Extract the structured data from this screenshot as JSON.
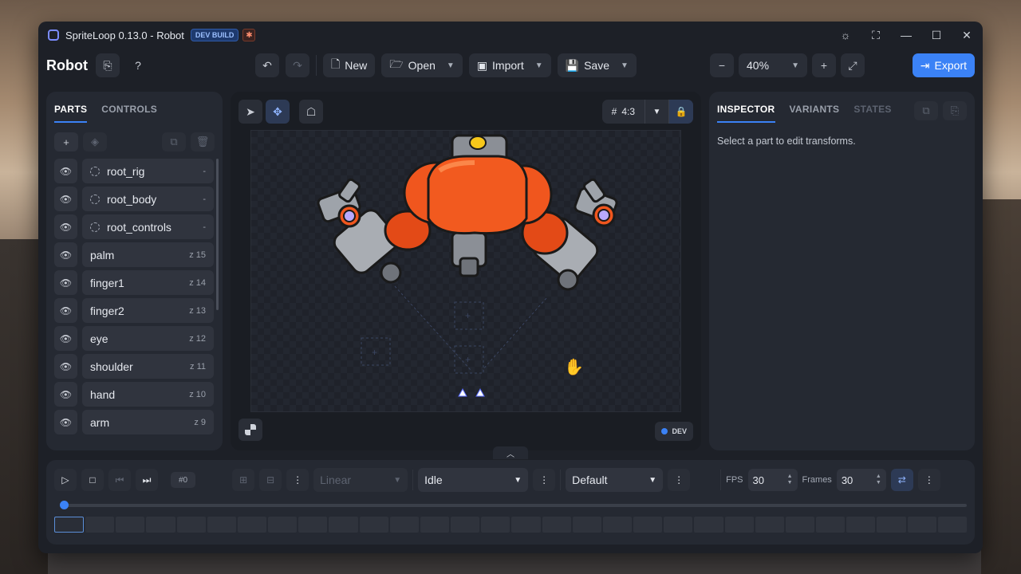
{
  "window": {
    "title": "SpriteLoop 0.13.0 - Robot",
    "badge": "DEV BUILD"
  },
  "toolbar": {
    "doc_title": "Robot",
    "new_label": "New",
    "open_label": "Open",
    "import_label": "Import",
    "save_label": "Save",
    "zoom": "40%",
    "export_label": "Export"
  },
  "left_panel": {
    "tabs": [
      "PARTS",
      "CONTROLS"
    ],
    "parts": [
      {
        "name": "root_rig",
        "z": "-",
        "group": true
      },
      {
        "name": "root_body",
        "z": "-",
        "group": true
      },
      {
        "name": "root_controls",
        "z": "-",
        "group": true
      },
      {
        "name": "palm",
        "z": "z 15",
        "group": false
      },
      {
        "name": "finger1",
        "z": "z 14",
        "group": false
      },
      {
        "name": "finger2",
        "z": "z 13",
        "group": false
      },
      {
        "name": "eye",
        "z": "z 12",
        "group": false
      },
      {
        "name": "shoulder",
        "z": "z 11",
        "group": false
      },
      {
        "name": "hand",
        "z": "z 10",
        "group": false
      },
      {
        "name": "arm",
        "z": "z 9",
        "group": false
      }
    ]
  },
  "canvas": {
    "aspect": "4:3",
    "dev_label": "DEV"
  },
  "right_panel": {
    "tabs": [
      "INSPECTOR",
      "VARIANTS",
      "STATES"
    ],
    "message": "Select a part to edit transforms."
  },
  "timeline": {
    "frame_id": "#0",
    "easing": "Linear",
    "animation": "Idle",
    "variant": "Default",
    "fps_label": "FPS",
    "fps": "30",
    "frames_label": "Frames",
    "frames": "30",
    "frame_count": 30,
    "progress": 0
  },
  "colors": {
    "accent": "#3b82f6",
    "robot_orange": "#f0561e"
  }
}
